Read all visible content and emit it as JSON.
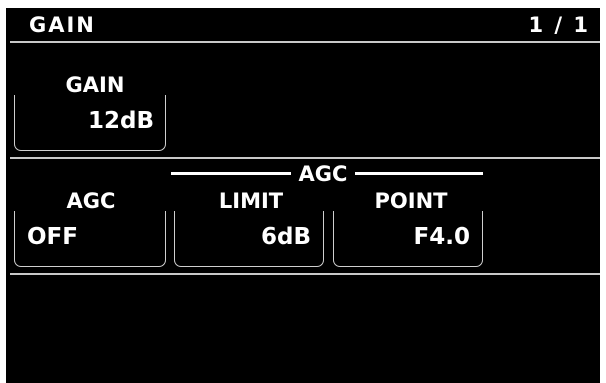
{
  "header": {
    "title": "GAIN",
    "page": "1 / 1"
  },
  "gain_section": {
    "gain": {
      "label": "GAIN",
      "value": "12dB"
    }
  },
  "agc_section": {
    "group_label": "AGC",
    "agc": {
      "label": "AGC",
      "value": "OFF"
    },
    "limit": {
      "label": "LIMIT",
      "value": "6dB"
    },
    "point": {
      "label": "POINT",
      "value": "F4.0"
    }
  }
}
